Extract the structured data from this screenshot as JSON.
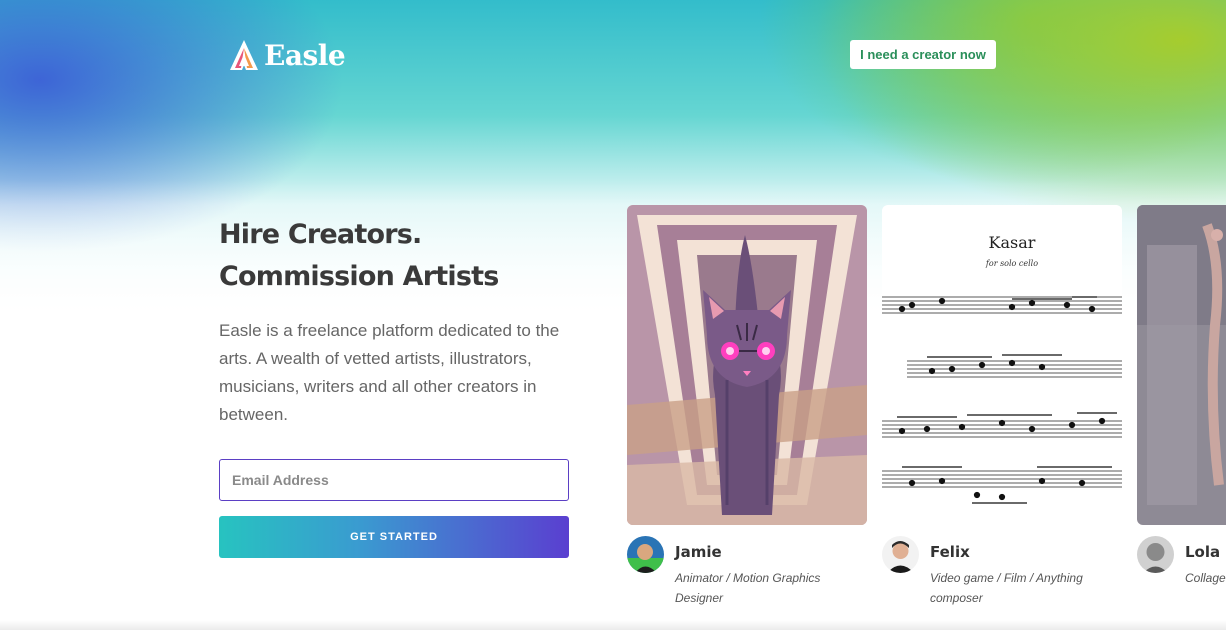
{
  "brand": {
    "name": "Easle"
  },
  "nav": {
    "cta_label": "I need a creator now"
  },
  "hero": {
    "headline": "Hire Creators. Commission Artists",
    "description": "Easle is a freelance platform dedicated to the arts. A wealth of vetted artists, illustrators, musicians, writers and all other creators in between.",
    "email_placeholder": "Email Address",
    "submit_label": "GET STARTED"
  },
  "creators": [
    {
      "name": "Jamie",
      "role": "Animator / Motion Graphics Designer",
      "artwork": "cat-illustration"
    },
    {
      "name": "Felix",
      "role": "Video game / Film / Anything composer",
      "artwork": "sheet-music",
      "artwork_text": {
        "title": "Kasar",
        "subtitle": "for solo cello"
      }
    },
    {
      "name": "Lola",
      "role": "Collage",
      "artwork": "collage"
    }
  ],
  "colors": {
    "accent": "#5b3fc4",
    "cta_text": "#2a8f5a",
    "gradient_start": "#27c3c0",
    "gradient_end": "#5a3fd0"
  }
}
